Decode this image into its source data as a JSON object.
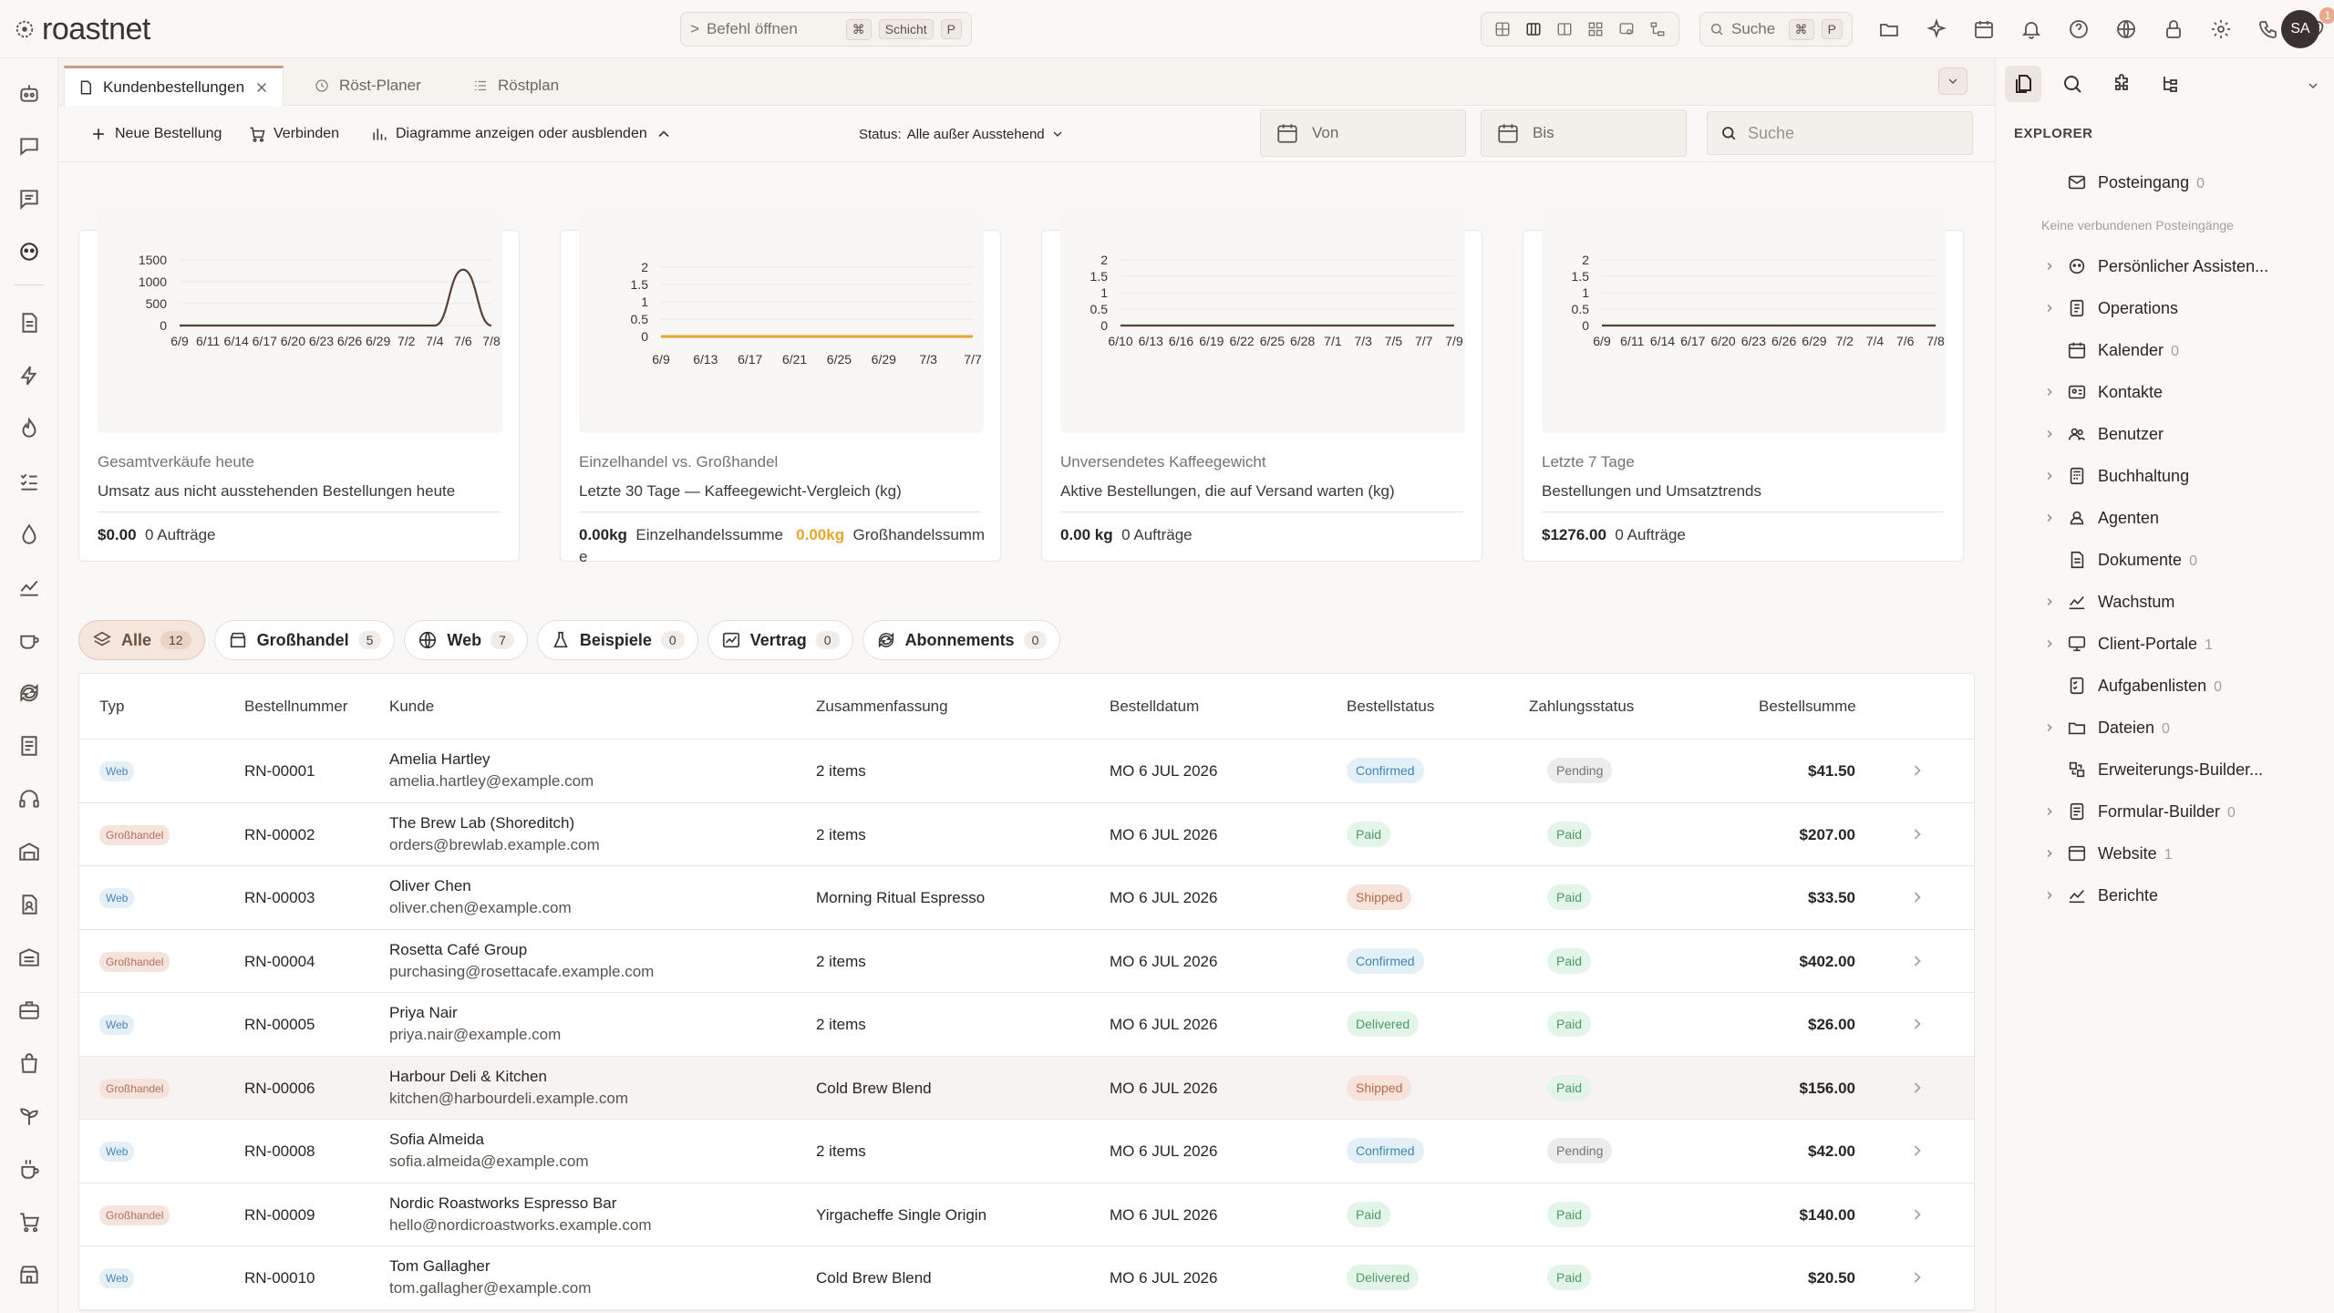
{
  "brand": {
    "name": "roastnet"
  },
  "command": {
    "label": "Befehl öffnen",
    "key1": "⌘",
    "key2": "Schicht",
    "key3": "P"
  },
  "topsearch": {
    "label": "Suche",
    "key1": "⌘",
    "key2": "P"
  },
  "notifications": {
    "count": "1"
  },
  "user": {
    "initials": "SA"
  },
  "tabs": [
    {
      "label": "Kundenbestellungen"
    },
    {
      "label": "Röst-Planer"
    },
    {
      "label": "Röstplan"
    }
  ],
  "toolbar": {
    "new_order": "Neue Bestellung",
    "connect": "Verbinden",
    "toggle_charts": "Diagramme anzeigen oder ausblenden",
    "status_label": "Status:",
    "status_value": "Alle außer Ausstehend",
    "from": "Von",
    "to": "Bis",
    "search_placeholder": "Suche"
  },
  "cards": [
    {
      "title": "Gesamtverkäufe heute",
      "subtitle": "Umsatz aus nicht ausstehenden Bestellungen heute",
      "amount": "$0.00",
      "orders": "0 Aufträge"
    },
    {
      "title": "Einzelhandel vs. Großhandel",
      "subtitle": "Letzte 30 Tage — Kaffeegewicht-Vergleich (kg)",
      "retail_value": "0.00kg",
      "retail_label": "Einzelhandelssumme",
      "wholesale_value": "0.00kg",
      "wholesale_label": "Großhandelssumme"
    },
    {
      "title": "Unversendetes Kaffeegewicht",
      "subtitle": "Aktive Bestellungen, die auf Versand warten (kg)",
      "amount": "0.00 kg",
      "orders": "0 Aufträge"
    },
    {
      "title": "Letzte 7 Tage",
      "subtitle": "Bestellungen und Umsatztrends",
      "amount": "$1276.00",
      "orders": "0 Aufträge"
    }
  ],
  "chart_data": [
    {
      "type": "line",
      "x": [
        "6/9",
        "6/11",
        "6/14",
        "6/17",
        "6/20",
        "6/23",
        "6/26",
        "6/29",
        "7/2",
        "7/4",
        "7/6",
        "7/8"
      ],
      "series": [
        {
          "values": [
            0,
            0,
            0,
            0,
            0,
            0,
            0,
            0,
            0,
            0,
            1276,
            0
          ]
        }
      ],
      "yticks": [
        "1500",
        "1000",
        "500",
        "0"
      ],
      "ylim": [
        0,
        1500
      ],
      "color": "#5a3f33"
    },
    {
      "type": "line",
      "x": [
        "6/9",
        "6/13",
        "6/17",
        "6/21",
        "6/25",
        "6/29",
        "7/3",
        "7/7"
      ],
      "series": [
        {
          "values": [
            0,
            0,
            0,
            0,
            0,
            0,
            0,
            0
          ]
        },
        {
          "values": [
            0,
            0,
            0,
            0,
            0,
            0,
            0,
            0
          ]
        }
      ],
      "yticks": [
        "2",
        "1.5",
        "1",
        "0.5",
        "0"
      ],
      "ylim": [
        0,
        2
      ],
      "colors": [
        "#5a3f33",
        "#e8a52c"
      ]
    },
    {
      "type": "line",
      "x": [
        "6/10",
        "6/13",
        "6/16",
        "6/19",
        "6/22",
        "6/25",
        "6/28",
        "7/1",
        "7/3",
        "7/5",
        "7/7",
        "7/9"
      ],
      "series": [
        {
          "values": [
            0,
            0,
            0,
            0,
            0,
            0,
            0,
            0,
            0,
            0,
            0,
            0
          ]
        }
      ],
      "yticks": [
        "2",
        "1.5",
        "1",
        "0.5",
        "0"
      ],
      "ylim": [
        0,
        2
      ],
      "color": "#5a3f33"
    },
    {
      "type": "line",
      "x": [
        "6/9",
        "6/11",
        "6/14",
        "6/17",
        "6/20",
        "6/23",
        "6/26",
        "6/29",
        "7/2",
        "7/4",
        "7/6",
        "7/8"
      ],
      "series": [
        {
          "values": [
            0,
            0,
            0,
            0,
            0,
            0,
            0,
            0,
            0,
            0,
            0,
            0
          ]
        }
      ],
      "yticks": [
        "2",
        "1.5",
        "1",
        "0.5",
        "0"
      ],
      "ylim": [
        0,
        2
      ],
      "color": "#5a3f33"
    }
  ],
  "filters": [
    {
      "label": "Alle",
      "count": "12",
      "icon": "layers-icon"
    },
    {
      "label": "Großhandel",
      "count": "5",
      "icon": "storefront-icon"
    },
    {
      "label": "Web",
      "count": "7",
      "icon": "globe-icon"
    },
    {
      "label": "Beispiele",
      "count": "0",
      "icon": "flask-icon"
    },
    {
      "label": "Vertrag",
      "count": "0",
      "icon": "chart-icon"
    },
    {
      "label": "Abonnements",
      "count": "0",
      "icon": "refresh-icon"
    }
  ],
  "table": {
    "headers": [
      "Typ",
      "Bestellnummer",
      "Kunde",
      "Zusammenfassung",
      "Bestelldatum",
      "Bestellstatus",
      "Zahlungsstatus",
      "Bestellsumme"
    ],
    "rows": [
      {
        "type": "Web",
        "order": "RN-00001",
        "name": "Amelia Hartley",
        "email": "amelia.hartley@example.com",
        "summary": "2 items",
        "date": "MO 6 JUL 2026",
        "status": "Confirmed",
        "payment": "Pending",
        "total": "$41.50"
      },
      {
        "type": "Großhandel",
        "order": "RN-00002",
        "name": "The Brew Lab (Shoreditch)",
        "email": "orders@brewlab.example.com",
        "summary": "2 items",
        "date": "MO 6 JUL 2026",
        "status": "Paid",
        "payment": "Paid",
        "total": "$207.00"
      },
      {
        "type": "Web",
        "order": "RN-00003",
        "name": "Oliver Chen",
        "email": "oliver.chen@example.com",
        "summary": "Morning Ritual Espresso",
        "date": "MO 6 JUL 2026",
        "status": "Shipped",
        "payment": "Paid",
        "total": "$33.50"
      },
      {
        "type": "Großhandel",
        "order": "RN-00004",
        "name": "Rosetta Café Group",
        "email": "purchasing@rosettacafe.example.com",
        "summary": "2 items",
        "date": "MO 6 JUL 2026",
        "status": "Confirmed",
        "payment": "Paid",
        "total": "$402.00"
      },
      {
        "type": "Web",
        "order": "RN-00005",
        "name": "Priya Nair",
        "email": "priya.nair@example.com",
        "summary": "2 items",
        "date": "MO 6 JUL 2026",
        "status": "Delivered",
        "payment": "Paid",
        "total": "$26.00"
      },
      {
        "type": "Großhandel",
        "order": "RN-00006",
        "name": "Harbour Deli & Kitchen",
        "email": "kitchen@harbourdeli.example.com",
        "summary": "Cold Brew Blend",
        "date": "MO 6 JUL 2026",
        "status": "Shipped",
        "payment": "Paid",
        "total": "$156.00"
      },
      {
        "type": "Web",
        "order": "RN-00008",
        "name": "Sofia Almeida",
        "email": "sofia.almeida@example.com",
        "summary": "2 items",
        "date": "MO 6 JUL 2026",
        "status": "Confirmed",
        "payment": "Pending",
        "total": "$42.00"
      },
      {
        "type": "Großhandel",
        "order": "RN-00009",
        "name": "Nordic Roastworks Espresso Bar",
        "email": "hello@nordicroastworks.example.com",
        "summary": "Yirgacheffe Single Origin",
        "date": "MO 6 JUL 2026",
        "status": "Paid",
        "payment": "Paid",
        "total": "$140.00"
      },
      {
        "type": "Web",
        "order": "RN-00010",
        "name": "Tom Gallagher",
        "email": "tom.gallagher@example.com",
        "summary": "Cold Brew Blend",
        "date": "MO 6 JUL 2026",
        "status": "Delivered",
        "payment": "Paid",
        "total": "$20.50"
      }
    ]
  },
  "explorer": {
    "heading": "EXPLORER",
    "note": "Keine verbundenen Posteingänge",
    "items": [
      {
        "label": "Posteingang",
        "count": "0",
        "chevron": false,
        "icon": "mail-icon"
      },
      {
        "label": "Persönlicher Assisten...",
        "count": "",
        "chevron": true,
        "icon": "assistant-icon"
      },
      {
        "label": "Operations",
        "count": "",
        "chevron": true,
        "icon": "operations-icon"
      },
      {
        "label": "Kalender",
        "count": "0",
        "chevron": false,
        "icon": "calendar-icon"
      },
      {
        "label": "Kontakte",
        "count": "",
        "chevron": true,
        "icon": "contacts-icon"
      },
      {
        "label": "Benutzer",
        "count": "",
        "chevron": true,
        "icon": "users-icon"
      },
      {
        "label": "Buchhaltung",
        "count": "",
        "chevron": true,
        "icon": "accounting-icon"
      },
      {
        "label": "Agenten",
        "count": "",
        "chevron": true,
        "icon": "agent-icon"
      },
      {
        "label": "Dokumente",
        "count": "0",
        "chevron": false,
        "icon": "document-icon"
      },
      {
        "label": "Wachstum",
        "count": "",
        "chevron": true,
        "icon": "growth-icon"
      },
      {
        "label": "Client-Portale",
        "count": "1",
        "chevron": true,
        "icon": "portal-icon"
      },
      {
        "label": "Aufgabenlisten",
        "count": "0",
        "chevron": false,
        "icon": "tasklist-icon"
      },
      {
        "label": "Dateien",
        "count": "0",
        "chevron": true,
        "icon": "folder-icon"
      },
      {
        "label": "Erweiterungs-Builder...",
        "count": "",
        "chevron": false,
        "icon": "extension-icon"
      },
      {
        "label": "Formular-Builder",
        "count": "0",
        "chevron": true,
        "icon": "form-icon"
      },
      {
        "label": "Website",
        "count": "1",
        "chevron": true,
        "icon": "website-icon"
      },
      {
        "label": "Berichte",
        "count": "",
        "chevron": true,
        "icon": "reports-icon"
      }
    ]
  }
}
